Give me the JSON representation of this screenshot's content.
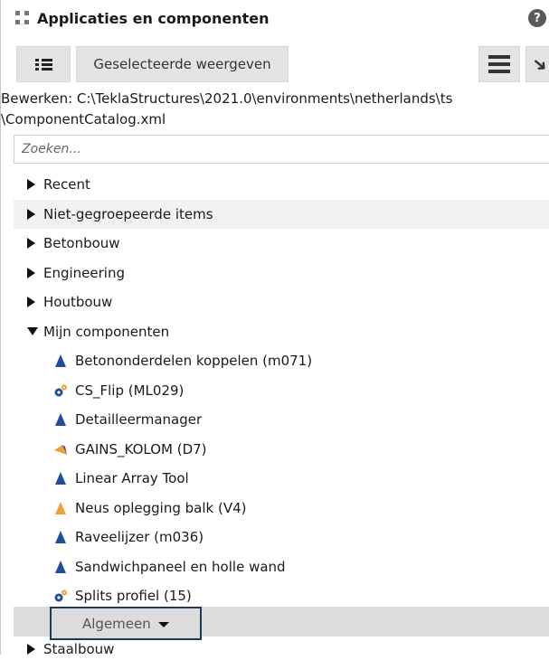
{
  "panel": {
    "title": "Applicaties en componenten",
    "help_glyph": "?"
  },
  "toolbar": {
    "show_selected_label": "Geselecteerde weergeven",
    "list_icon": "list-view-icon",
    "menu_icon": "hamburger-menu-icon",
    "pin_icon": "pin-icon"
  },
  "edit_path": {
    "line1": "Bewerken:  C:\\TeklaStructures\\2021.0\\environments\\netherlands\\ts",
    "line2": "\\ComponentCatalog.xml"
  },
  "search": {
    "placeholder": "Zoeken...",
    "value": ""
  },
  "tree": {
    "groups_top": [
      {
        "label": "Recent",
        "expanded": false
      },
      {
        "label": "Niet-gegroepeerde items",
        "expanded": false
      },
      {
        "label": "Betonbouw",
        "expanded": false
      },
      {
        "label": "Engineering",
        "expanded": false
      },
      {
        "label": "Houtbouw",
        "expanded": false
      },
      {
        "label": "Mijn componenten",
        "expanded": true
      }
    ],
    "my_components": [
      {
        "label": "Betononderdelen koppelen (m071)",
        "icon": "blue-component-icon"
      },
      {
        "label": "CS_Flip (ML029)",
        "icon": "plugin-gear-icon"
      },
      {
        "label": "Detailleermanager",
        "icon": "blue-component-icon"
      },
      {
        "label": "GAINS_KOLOM (D7)",
        "icon": "orange-detail-icon"
      },
      {
        "label": "Linear Array Tool",
        "icon": "blue-component-icon"
      },
      {
        "label": "Neus oplegging balk (V4)",
        "icon": "orange-component-icon"
      },
      {
        "label": "Raveelijzer (m036)",
        "icon": "blue-component-icon"
      },
      {
        "label": "Sandwichpaneel en holle wand",
        "icon": "blue-component-icon"
      },
      {
        "label": "Splits profiel (15)",
        "icon": "plugin-gear-icon"
      }
    ],
    "subgroup": {
      "label": "Algemeen"
    },
    "groups_bottom": [
      {
        "label": "Staalbouw",
        "expanded": false
      }
    ]
  },
  "colors": {
    "blue_icon": "#1f4e9c",
    "orange_icon": "#f0a030",
    "selection_border": "#1f3a5a"
  }
}
